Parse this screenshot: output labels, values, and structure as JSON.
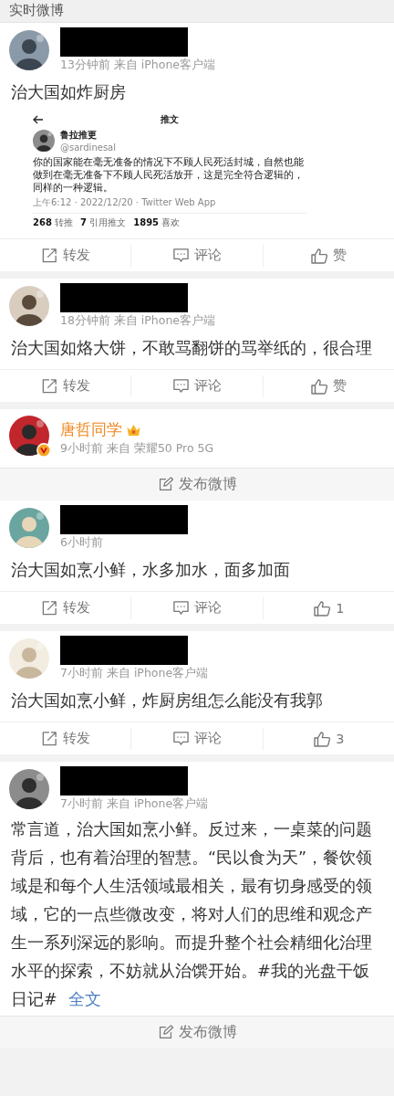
{
  "section_title": "实时微博",
  "feed": [
    {
      "kind": "post",
      "meta": "13分钟前 来自 iPhone客户端",
      "text": "治大国如炸厨房",
      "embed": {
        "header_title": "推文",
        "author_name": "鲁拉推更",
        "handle": "@sardinesal",
        "text": "你的国家能在毫无准备的情况下不顾人民死活封城，自然也能做到在毫无准备下不顾人民死活放开，这是完全符合逻辑的，同样的一种逻辑。",
        "timestamp": "上午6:12 · 2022/12/20 · Twitter Web App",
        "stats": [
          {
            "count": "268",
            "label": "转推"
          },
          {
            "count": "7",
            "label": "引用推文"
          },
          {
            "count": "1895",
            "label": "喜欢"
          }
        ]
      },
      "actions": [
        {
          "kind": "repost",
          "label": "转发"
        },
        {
          "kind": "comment",
          "label": "评论"
        },
        {
          "kind": "like",
          "label": "赞"
        }
      ]
    },
    {
      "kind": "post",
      "meta": "18分钟前 来自 iPhone客户端",
      "text": "治大国如烙大饼，不敢骂翻饼的骂举纸的，很合理",
      "actions": [
        {
          "kind": "repost",
          "label": "转发"
        },
        {
          "kind": "comment",
          "label": "评论"
        },
        {
          "kind": "like",
          "label": "赞"
        }
      ]
    },
    {
      "kind": "post",
      "author": "唐哲同学",
      "verified": true,
      "vip": true,
      "meta": "9小时前 来自 荣耀50 Pro 5G"
    },
    {
      "kind": "compose",
      "label": "发布微博"
    },
    {
      "kind": "post",
      "meta": "6小时前",
      "text": "治大国如烹小鲜，水多加水，面多加面",
      "actions": [
        {
          "kind": "repost",
          "label": "转发"
        },
        {
          "kind": "comment",
          "label": "评论"
        },
        {
          "kind": "like",
          "label": "1"
        }
      ]
    },
    {
      "kind": "post",
      "meta": "7小时前 来自 iPhone客户端",
      "text": "治大国如烹小鲜，炸厨房组怎么能没有我郭",
      "actions": [
        {
          "kind": "repost",
          "label": "转发"
        },
        {
          "kind": "comment",
          "label": "评论"
        },
        {
          "kind": "like",
          "label": "3"
        }
      ]
    },
    {
      "kind": "post",
      "meta": "7小时前 来自 iPhone客户端",
      "text": "常言道，治大国如烹小鲜。反过来，一桌菜的问题背后，也有着治理的智慧。“民以食为天”，餐饮领域是和每个人生活领域最相关，最有切身感受的领域，它的一点些微改变，将对人们的思维和观念产生一系列深远的影响。而提升整个社会精细化治理水平的探索，不妨就从治馔开始。#我的光盘干饭日记#",
      "more_link": "全文"
    },
    {
      "kind": "compose",
      "label": "发布微博"
    }
  ]
}
